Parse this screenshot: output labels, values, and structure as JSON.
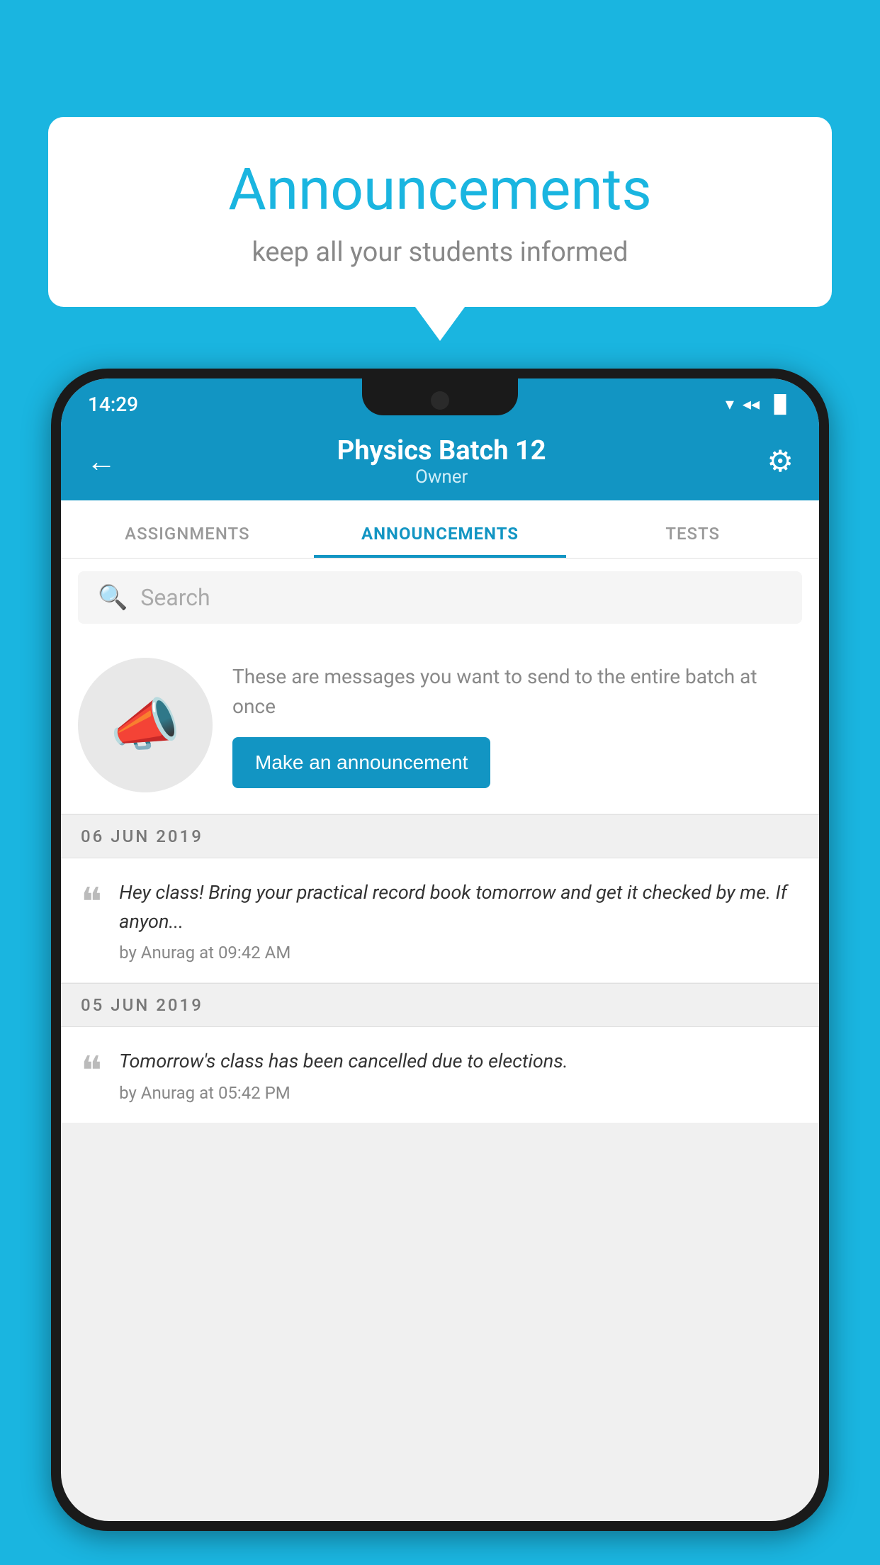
{
  "page": {
    "background_color": "#1ab5e0"
  },
  "speech_bubble": {
    "title": "Announcements",
    "subtitle": "keep all your students informed"
  },
  "status_bar": {
    "time": "14:29",
    "wifi_icon": "▼",
    "signal_icon": "▲",
    "battery_icon": "▐"
  },
  "app_bar": {
    "back_icon": "←",
    "title": "Physics Batch 12",
    "subtitle": "Owner",
    "settings_icon": "⚙"
  },
  "tabs": [
    {
      "label": "ASSIGNMENTS",
      "active": false
    },
    {
      "label": "ANNOUNCEMENTS",
      "active": true
    },
    {
      "label": "TESTS",
      "active": false
    }
  ],
  "search": {
    "placeholder": "Search"
  },
  "promo": {
    "description": "These are messages you want to send to the entire batch at once",
    "button_label": "Make an announcement"
  },
  "announcements": [
    {
      "date": "06  JUN  2019",
      "text": "Hey class! Bring your practical record book tomorrow and get it checked by me. If anyon...",
      "author": "by Anurag at 09:42 AM"
    },
    {
      "date": "05  JUN  2019",
      "text": "Tomorrow's class has been cancelled due to elections.",
      "author": "by Anurag at 05:42 PM"
    }
  ]
}
